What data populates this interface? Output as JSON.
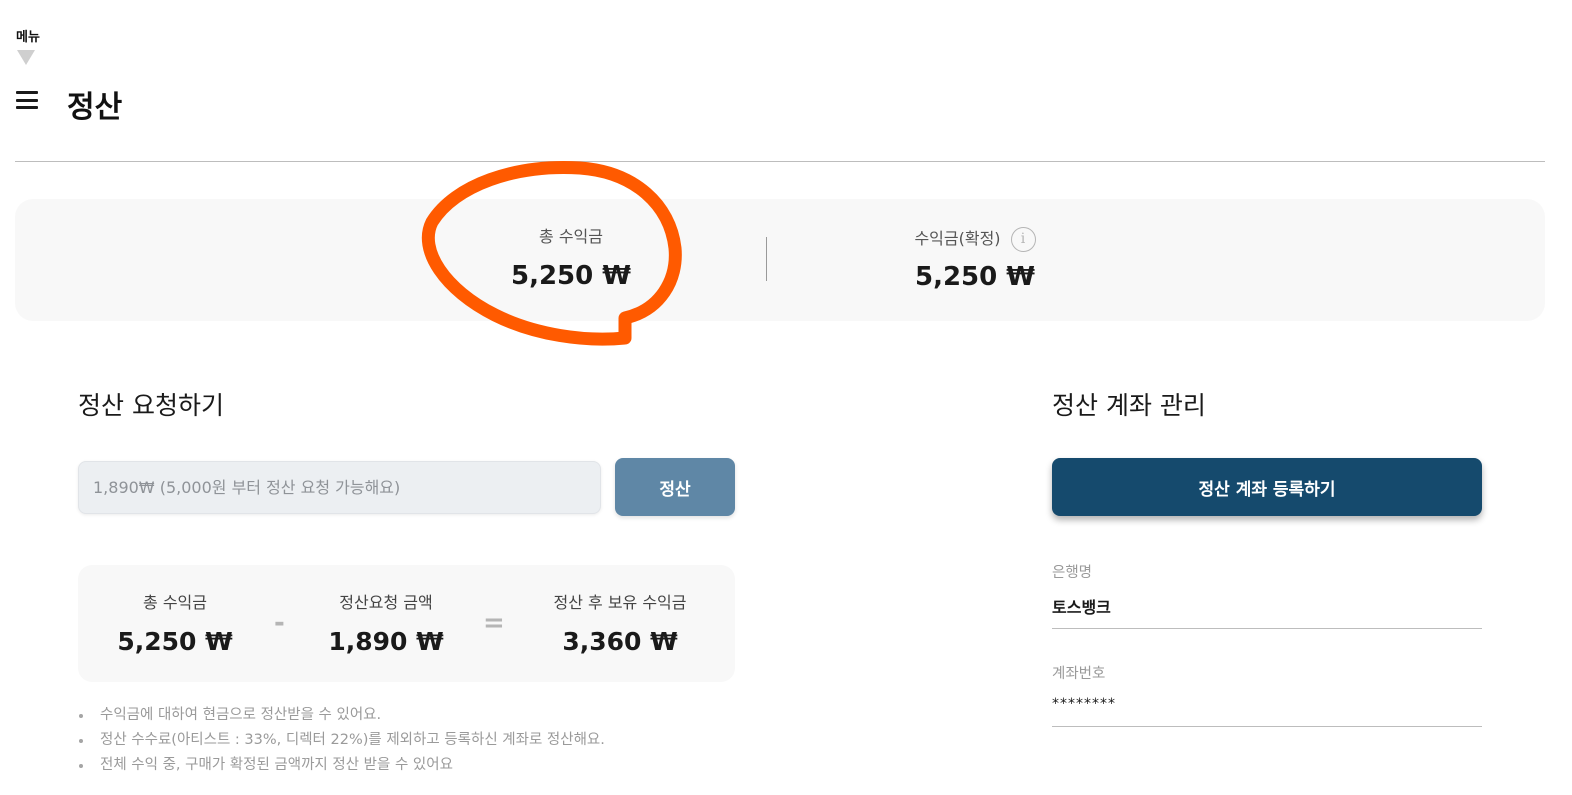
{
  "header": {
    "menu_label": "메뉴",
    "title": "정산"
  },
  "summary": {
    "total_label": "총 수익금",
    "total_value": "5,250 ₩",
    "confirmed_label": "수익금(확정)",
    "confirmed_value": "5,250 ₩",
    "info_icon": "i"
  },
  "request": {
    "title": "정산 요청하기",
    "input_placeholder": "1,890₩ (5,000원 부터 정산 요청 가능해요)",
    "button_label": "정산",
    "calc": {
      "total_label": "총 수익금",
      "total_value": "5,250 ₩",
      "minus": "-",
      "request_label": "정산요청 금액",
      "request_value": "1,890 ₩",
      "equals": "=",
      "after_label": "정산 후 보유 수익금",
      "after_value": "3,360 ₩"
    },
    "notes": [
      "수익금에 대하여 현금으로 정산받을 수 있어요.",
      "정산 수수료(아티스트 : 33%, 디렉터 22%)를 제외하고 등록하신 계좌로 정산해요.",
      "전체 수익 중, 구매가 확정된 금액까지 정산 받을 수 있어요"
    ]
  },
  "account": {
    "title": "정산 계좌 관리",
    "register_button": "정산 계좌 등록하기",
    "bank_label": "은행명",
    "bank_value": "토스뱅크",
    "account_label": "계좌번호",
    "account_value": "********"
  },
  "colors": {
    "highlight": "#ff5a00",
    "primary_button": "#154a6d",
    "secondary_button": "#5f87a6"
  },
  "icons": [
    "chevron-down-icon",
    "hamburger-menu-icon",
    "info-icon"
  ]
}
